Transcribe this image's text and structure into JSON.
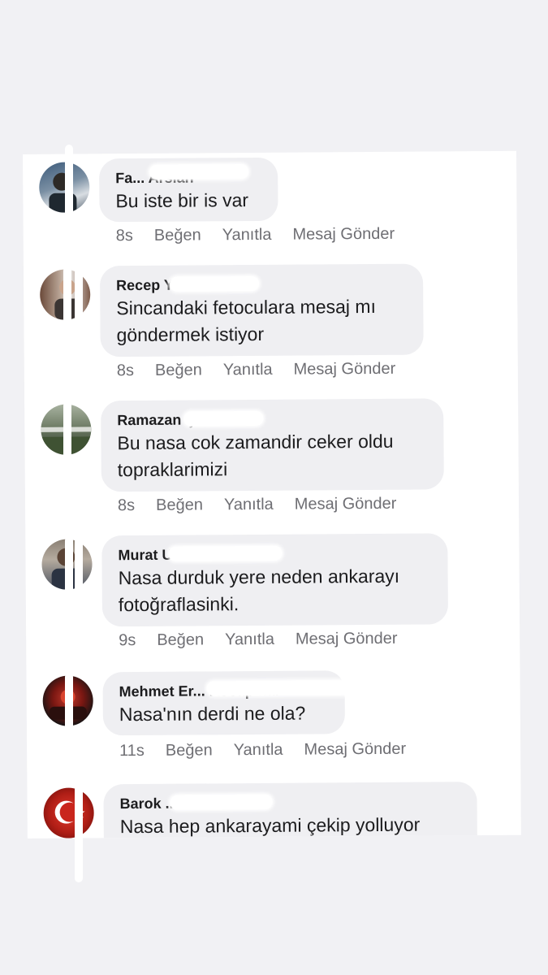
{
  "comments": [
    {
      "name": "Fa... Arslan",
      "text": "Bu iste bir is var",
      "time": "8s",
      "like": "Beğen",
      "reply": "Yanıtla",
      "message": "Mesaj Gönder"
    },
    {
      "name": "Recep Yıldız",
      "text": "Sincandaki fetoculara mesaj mı\ngöndermek istiyor",
      "time": "8s",
      "like": "Beğen",
      "reply": "Yanıtla",
      "message": "Mesaj Gönder"
    },
    {
      "name": "Ramazan Çamlı",
      "text": "Bu nasa cok zamandir ceker oldu\ntopraklarimizi",
      "time": "8s",
      "like": "Beğen",
      "reply": "Yanıtla",
      "message": "Mesaj Gönder"
    },
    {
      "name": "Murat Uzunalı",
      "text": "Nasa durduk yere neden ankarayı\nfotoğraflasinki.",
      "time": "9s",
      "like": "Beğen",
      "reply": "Yanıtla",
      "message": "Mesaj Gönder"
    },
    {
      "name": "Mehmet Er... Kocapınar",
      "text": "Nasa'nın derdi ne ola?",
      "time": "11s",
      "like": "Beğen",
      "reply": "Yanıtla",
      "message": "Mesaj Gönder"
    },
    {
      "name": "Barok ...",
      "text": "Nasa hep ankarayami çekip yolluyor"
    }
  ],
  "colors": {
    "bubble": "#efeff2",
    "text": "#1c1c1e",
    "meta": "#6e6e73",
    "background": "#f1f1f4"
  }
}
